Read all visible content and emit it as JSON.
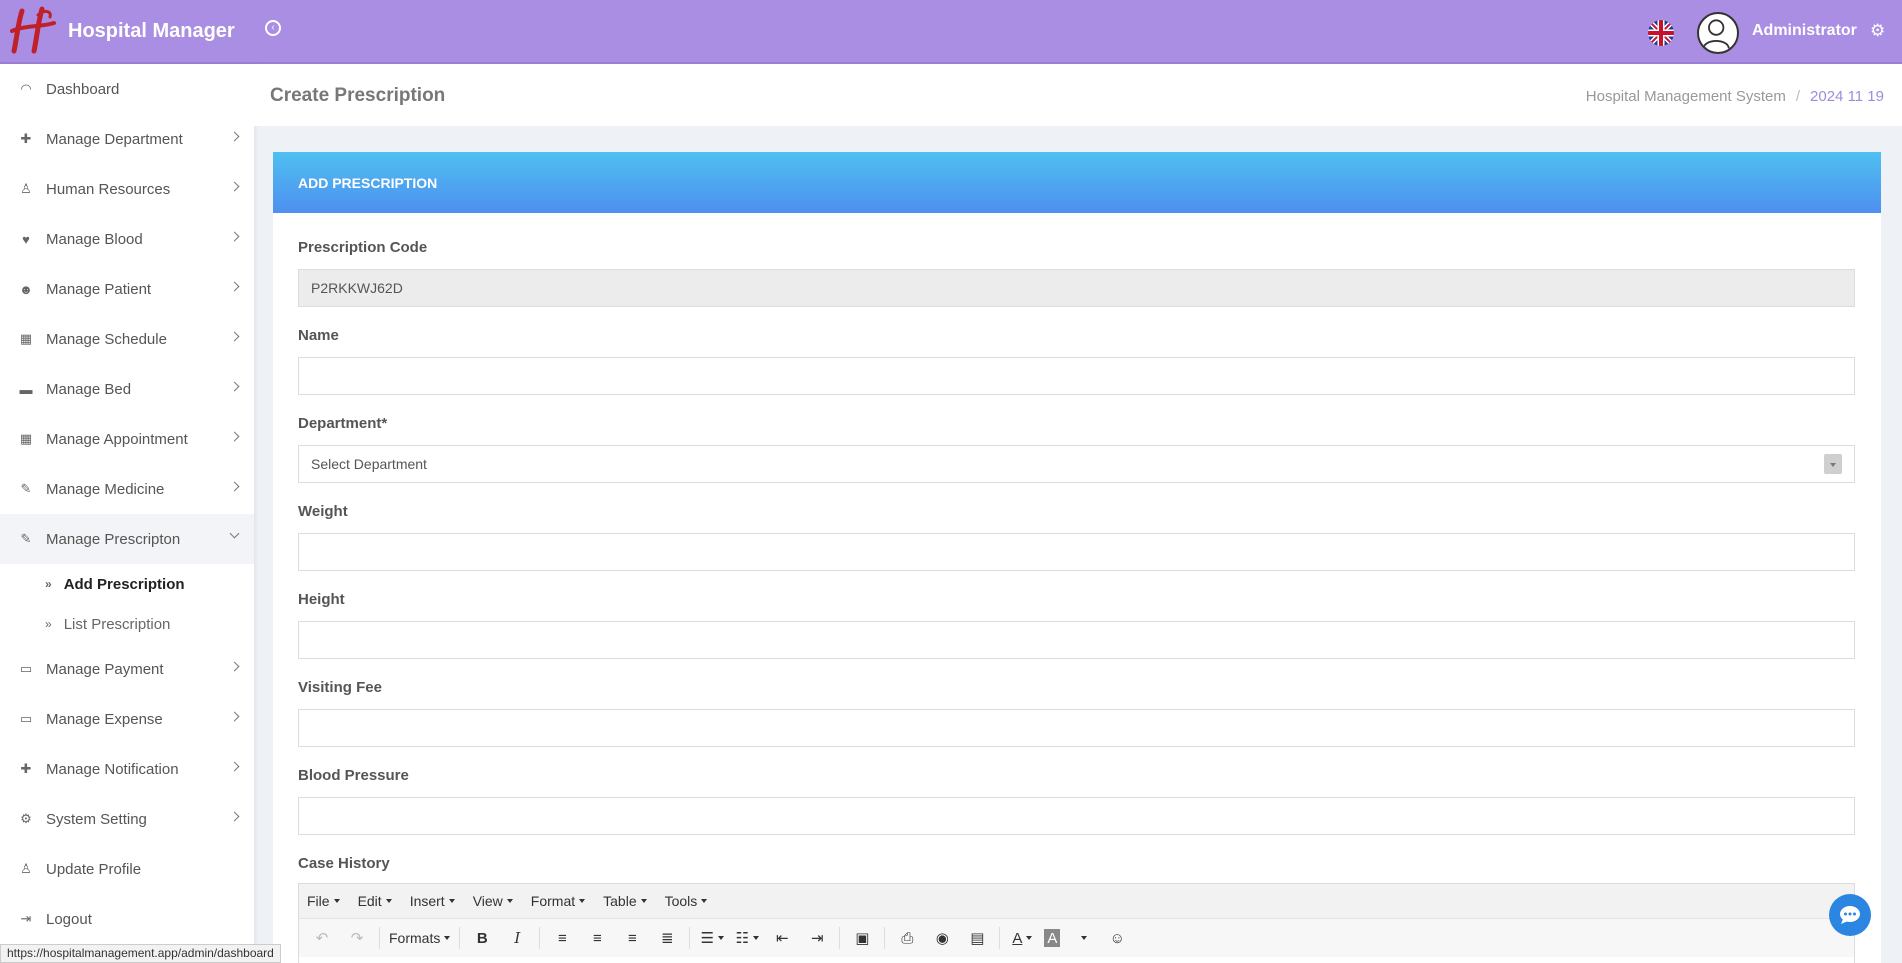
{
  "header": {
    "brand_name": "Hospital Manager",
    "user_name": "Administrator",
    "accent_color": "#a98ee3"
  },
  "sidebar": {
    "items": [
      {
        "label": "Dashboard",
        "icon": "dashboard-icon"
      },
      {
        "label": "Manage Department",
        "icon": "plus-icon"
      },
      {
        "label": "Human Resources",
        "icon": "user-md-icon"
      },
      {
        "label": "Manage Blood",
        "icon": "heart-icon"
      },
      {
        "label": "Manage Patient",
        "icon": "users-icon"
      },
      {
        "label": "Manage Schedule",
        "icon": "calendar-icon"
      },
      {
        "label": "Manage Bed",
        "icon": "bed-icon"
      },
      {
        "label": "Manage Appointment",
        "icon": "calendar-icon"
      },
      {
        "label": "Manage Medicine",
        "icon": "edit-icon"
      },
      {
        "label": "Manage Prescripton",
        "icon": "edit-icon"
      },
      {
        "label": "Manage Payment",
        "icon": "credit-card-icon"
      },
      {
        "label": "Manage Expense",
        "icon": "credit-card-icon"
      },
      {
        "label": "Manage Notification",
        "icon": "plus-icon"
      },
      {
        "label": "System Setting",
        "icon": "cogs-icon"
      },
      {
        "label": "Update Profile",
        "icon": "user-icon"
      },
      {
        "label": "Logout",
        "icon": "logout-icon"
      }
    ],
    "sub_items": [
      {
        "label": "Add Prescription"
      },
      {
        "label": "List Prescription"
      }
    ]
  },
  "page": {
    "title": "Create Prescription",
    "breadcrumb_home": "Hospital Management System",
    "breadcrumb_date": "2024 11 19"
  },
  "card": {
    "title": "ADD PRESCRIPTION"
  },
  "form": {
    "code_label": "Prescription Code",
    "code_value": "P2RKKWJ62D",
    "name_label": "Name",
    "department_label": "Department*",
    "department_value": "Select Department",
    "weight_label": "Weight",
    "height_label": "Height",
    "fee_label": "Visiting Fee",
    "bp_label": "Blood Pressure",
    "history_label": "Case History"
  },
  "editor": {
    "menus": [
      "File",
      "Edit",
      "Insert",
      "View",
      "Format",
      "Table",
      "Tools"
    ],
    "formats_label": "Formats"
  },
  "status": {
    "url": "https://hospitalmanagement.app/admin/dashboard"
  }
}
